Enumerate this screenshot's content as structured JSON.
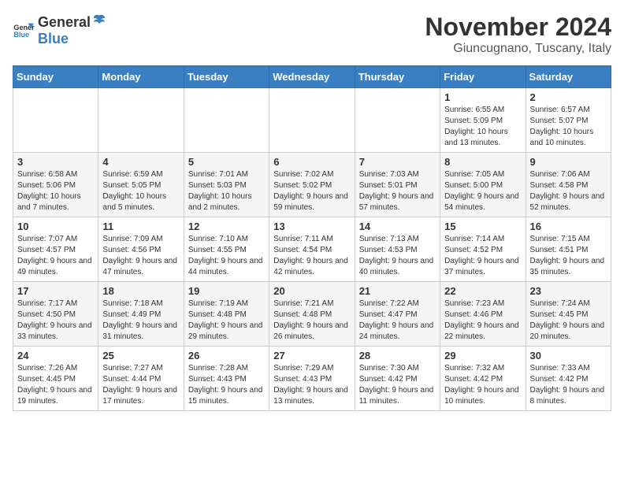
{
  "logo": {
    "text_general": "General",
    "text_blue": "Blue"
  },
  "header": {
    "month": "November 2024",
    "location": "Giuncugnano, Tuscany, Italy"
  },
  "days_of_week": [
    "Sunday",
    "Monday",
    "Tuesday",
    "Wednesday",
    "Thursday",
    "Friday",
    "Saturday"
  ],
  "weeks": [
    [
      {
        "day": "",
        "info": ""
      },
      {
        "day": "",
        "info": ""
      },
      {
        "day": "",
        "info": ""
      },
      {
        "day": "",
        "info": ""
      },
      {
        "day": "",
        "info": ""
      },
      {
        "day": "1",
        "info": "Sunrise: 6:55 AM\nSunset: 5:09 PM\nDaylight: 10 hours and 13 minutes."
      },
      {
        "day": "2",
        "info": "Sunrise: 6:57 AM\nSunset: 5:07 PM\nDaylight: 10 hours and 10 minutes."
      }
    ],
    [
      {
        "day": "3",
        "info": "Sunrise: 6:58 AM\nSunset: 5:06 PM\nDaylight: 10 hours and 7 minutes."
      },
      {
        "day": "4",
        "info": "Sunrise: 6:59 AM\nSunset: 5:05 PM\nDaylight: 10 hours and 5 minutes."
      },
      {
        "day": "5",
        "info": "Sunrise: 7:01 AM\nSunset: 5:03 PM\nDaylight: 10 hours and 2 minutes."
      },
      {
        "day": "6",
        "info": "Sunrise: 7:02 AM\nSunset: 5:02 PM\nDaylight: 9 hours and 59 minutes."
      },
      {
        "day": "7",
        "info": "Sunrise: 7:03 AM\nSunset: 5:01 PM\nDaylight: 9 hours and 57 minutes."
      },
      {
        "day": "8",
        "info": "Sunrise: 7:05 AM\nSunset: 5:00 PM\nDaylight: 9 hours and 54 minutes."
      },
      {
        "day": "9",
        "info": "Sunrise: 7:06 AM\nSunset: 4:58 PM\nDaylight: 9 hours and 52 minutes."
      }
    ],
    [
      {
        "day": "10",
        "info": "Sunrise: 7:07 AM\nSunset: 4:57 PM\nDaylight: 9 hours and 49 minutes."
      },
      {
        "day": "11",
        "info": "Sunrise: 7:09 AM\nSunset: 4:56 PM\nDaylight: 9 hours and 47 minutes."
      },
      {
        "day": "12",
        "info": "Sunrise: 7:10 AM\nSunset: 4:55 PM\nDaylight: 9 hours and 44 minutes."
      },
      {
        "day": "13",
        "info": "Sunrise: 7:11 AM\nSunset: 4:54 PM\nDaylight: 9 hours and 42 minutes."
      },
      {
        "day": "14",
        "info": "Sunrise: 7:13 AM\nSunset: 4:53 PM\nDaylight: 9 hours and 40 minutes."
      },
      {
        "day": "15",
        "info": "Sunrise: 7:14 AM\nSunset: 4:52 PM\nDaylight: 9 hours and 37 minutes."
      },
      {
        "day": "16",
        "info": "Sunrise: 7:15 AM\nSunset: 4:51 PM\nDaylight: 9 hours and 35 minutes."
      }
    ],
    [
      {
        "day": "17",
        "info": "Sunrise: 7:17 AM\nSunset: 4:50 PM\nDaylight: 9 hours and 33 minutes."
      },
      {
        "day": "18",
        "info": "Sunrise: 7:18 AM\nSunset: 4:49 PM\nDaylight: 9 hours and 31 minutes."
      },
      {
        "day": "19",
        "info": "Sunrise: 7:19 AM\nSunset: 4:48 PM\nDaylight: 9 hours and 29 minutes."
      },
      {
        "day": "20",
        "info": "Sunrise: 7:21 AM\nSunset: 4:48 PM\nDaylight: 9 hours and 26 minutes."
      },
      {
        "day": "21",
        "info": "Sunrise: 7:22 AM\nSunset: 4:47 PM\nDaylight: 9 hours and 24 minutes."
      },
      {
        "day": "22",
        "info": "Sunrise: 7:23 AM\nSunset: 4:46 PM\nDaylight: 9 hours and 22 minutes."
      },
      {
        "day": "23",
        "info": "Sunrise: 7:24 AM\nSunset: 4:45 PM\nDaylight: 9 hours and 20 minutes."
      }
    ],
    [
      {
        "day": "24",
        "info": "Sunrise: 7:26 AM\nSunset: 4:45 PM\nDaylight: 9 hours and 19 minutes."
      },
      {
        "day": "25",
        "info": "Sunrise: 7:27 AM\nSunset: 4:44 PM\nDaylight: 9 hours and 17 minutes."
      },
      {
        "day": "26",
        "info": "Sunrise: 7:28 AM\nSunset: 4:43 PM\nDaylight: 9 hours and 15 minutes."
      },
      {
        "day": "27",
        "info": "Sunrise: 7:29 AM\nSunset: 4:43 PM\nDaylight: 9 hours and 13 minutes."
      },
      {
        "day": "28",
        "info": "Sunrise: 7:30 AM\nSunset: 4:42 PM\nDaylight: 9 hours and 11 minutes."
      },
      {
        "day": "29",
        "info": "Sunrise: 7:32 AM\nSunset: 4:42 PM\nDaylight: 9 hours and 10 minutes."
      },
      {
        "day": "30",
        "info": "Sunrise: 7:33 AM\nSunset: 4:42 PM\nDaylight: 9 hours and 8 minutes."
      }
    ]
  ]
}
